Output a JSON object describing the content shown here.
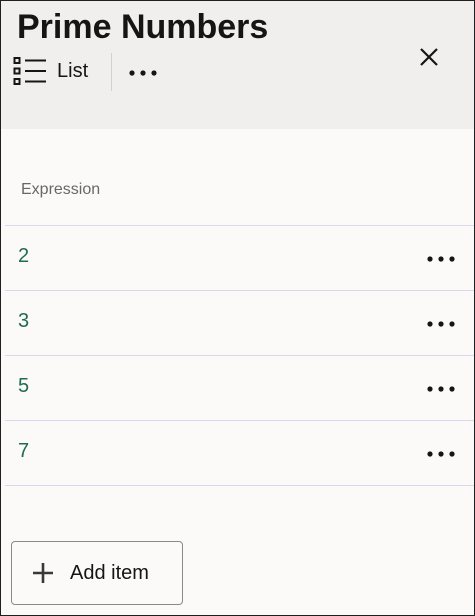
{
  "header": {
    "title": "Prime Numbers",
    "view_label": "List",
    "view_icon": "list-view-icon",
    "more_icon": "more-horizontal-icon",
    "close_icon": "close-icon"
  },
  "table": {
    "column_header": "Expression",
    "rows": [
      {
        "value": "2"
      },
      {
        "value": "3"
      },
      {
        "value": "5"
      },
      {
        "value": "7"
      }
    ],
    "row_action_icon": "more-horizontal-icon"
  },
  "footer": {
    "add_label": "Add item",
    "add_icon": "plus-icon"
  },
  "colors": {
    "header_bg": "#f1efed",
    "page_bg": "#fbfaf8",
    "value_text": "#1f6b55",
    "row_divider": "#dcd7ec"
  }
}
